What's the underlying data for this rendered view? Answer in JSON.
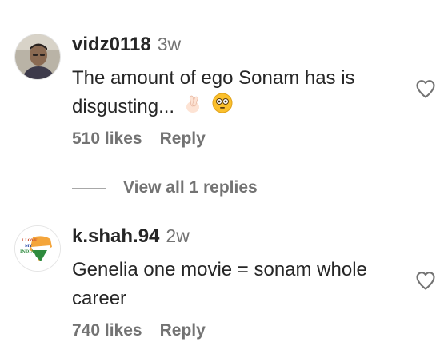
{
  "comments": [
    {
      "username": "vidz0118",
      "time": "3w",
      "text": "The amount of ego Sonam has is disgusting...",
      "emojis": [
        "crossed-fingers-emoji",
        "flushed-face-emoji"
      ],
      "likes": "510 likes",
      "reply": "Reply"
    },
    {
      "username": "k.shah.94",
      "time": "2w",
      "text": "Genelia one movie = sonam whole career",
      "likes": "740 likes",
      "reply": "Reply",
      "avatar_text": "I LOVE MY INDIA"
    }
  ],
  "view_replies": "View all 1 replies",
  "colors": {
    "text": "#262626",
    "secondary": "#737373",
    "saffron": "#f4a53b",
    "green": "#2e8b3e"
  }
}
